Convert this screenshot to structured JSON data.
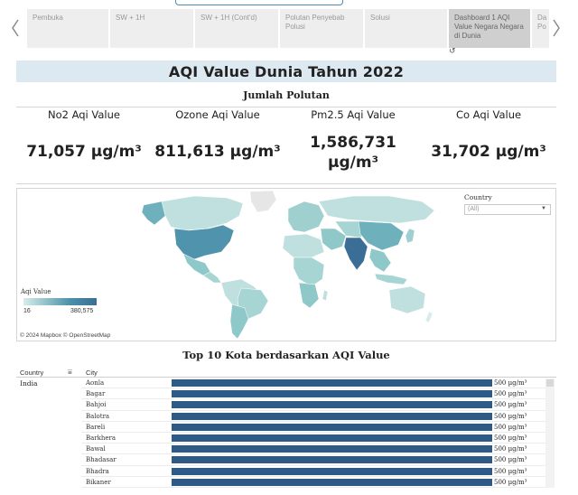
{
  "story": {
    "tabs": [
      {
        "label": "Pembuka",
        "width": 92,
        "active": false
      },
      {
        "label": "SW + 1H",
        "width": 94,
        "active": false
      },
      {
        "label": "SW + 1H (Cont'd)",
        "width": 94,
        "active": false
      },
      {
        "label": "Polutan Penyebab Polusi",
        "width": 94,
        "active": false
      },
      {
        "label": "Solusi",
        "width": 93,
        "active": false
      },
      {
        "label": "Dashboard 1 AQI Value Negara Negara di Dunia",
        "width": 92,
        "active": true
      },
      {
        "label": "Da Po",
        "width": 30,
        "active": false
      }
    ],
    "prev_icon": "chevron-left-icon",
    "next_icon": "chevron-right-icon",
    "refresh_glyph": "↺"
  },
  "title": "AQI Value Dunia Tahun 2022",
  "kpi": {
    "heading": "Jumlah Polutan",
    "items": [
      {
        "label": "No2 Aqi Value",
        "value": "71,057 µg/m³"
      },
      {
        "label": "Ozone Aqi Value",
        "value": "811,613 µg/m³"
      },
      {
        "label": "Pm2.5 Aqi Value",
        "value": "1,586,731 µg/m³"
      },
      {
        "label": "Co Aqi Value",
        "value": "31,702 µg/m³"
      }
    ]
  },
  "map": {
    "credit": "© 2024 Mapbox © OpenStreetMap",
    "legend_title": "Aqi Value",
    "legend_min": "16",
    "legend_max": "380,575",
    "filter_label": "Country",
    "filter_value": "(All)",
    "colors": {
      "low": "#d6ecea",
      "mid": "#9fcfcf",
      "high": "#4a8fa7",
      "max": "#3a6e96",
      "nodata": "#e6e6e6"
    }
  },
  "table": {
    "title": "Top 10 Kota berdasarkan AQI Value",
    "col_country": "Country",
    "col_city": "City",
    "country": "India",
    "rows": [
      {
        "city": "Aonla",
        "value": "500 µg/m³"
      },
      {
        "city": "Bagar",
        "value": "500 µg/m³"
      },
      {
        "city": "Bahjoi",
        "value": "500 µg/m³"
      },
      {
        "city": "Balotra",
        "value": "500 µg/m³"
      },
      {
        "city": "Bareli",
        "value": "500 µg/m³"
      },
      {
        "city": "Barkhera",
        "value": "500 µg/m³"
      },
      {
        "city": "Bawal",
        "value": "500 µg/m³"
      },
      {
        "city": "Bhadasar",
        "value": "500 µg/m³"
      },
      {
        "city": "Bhadra",
        "value": "500 µg/m³"
      },
      {
        "city": "Bikaner",
        "value": "500 µg/m³"
      }
    ],
    "bar_color": "#2d5a86"
  }
}
